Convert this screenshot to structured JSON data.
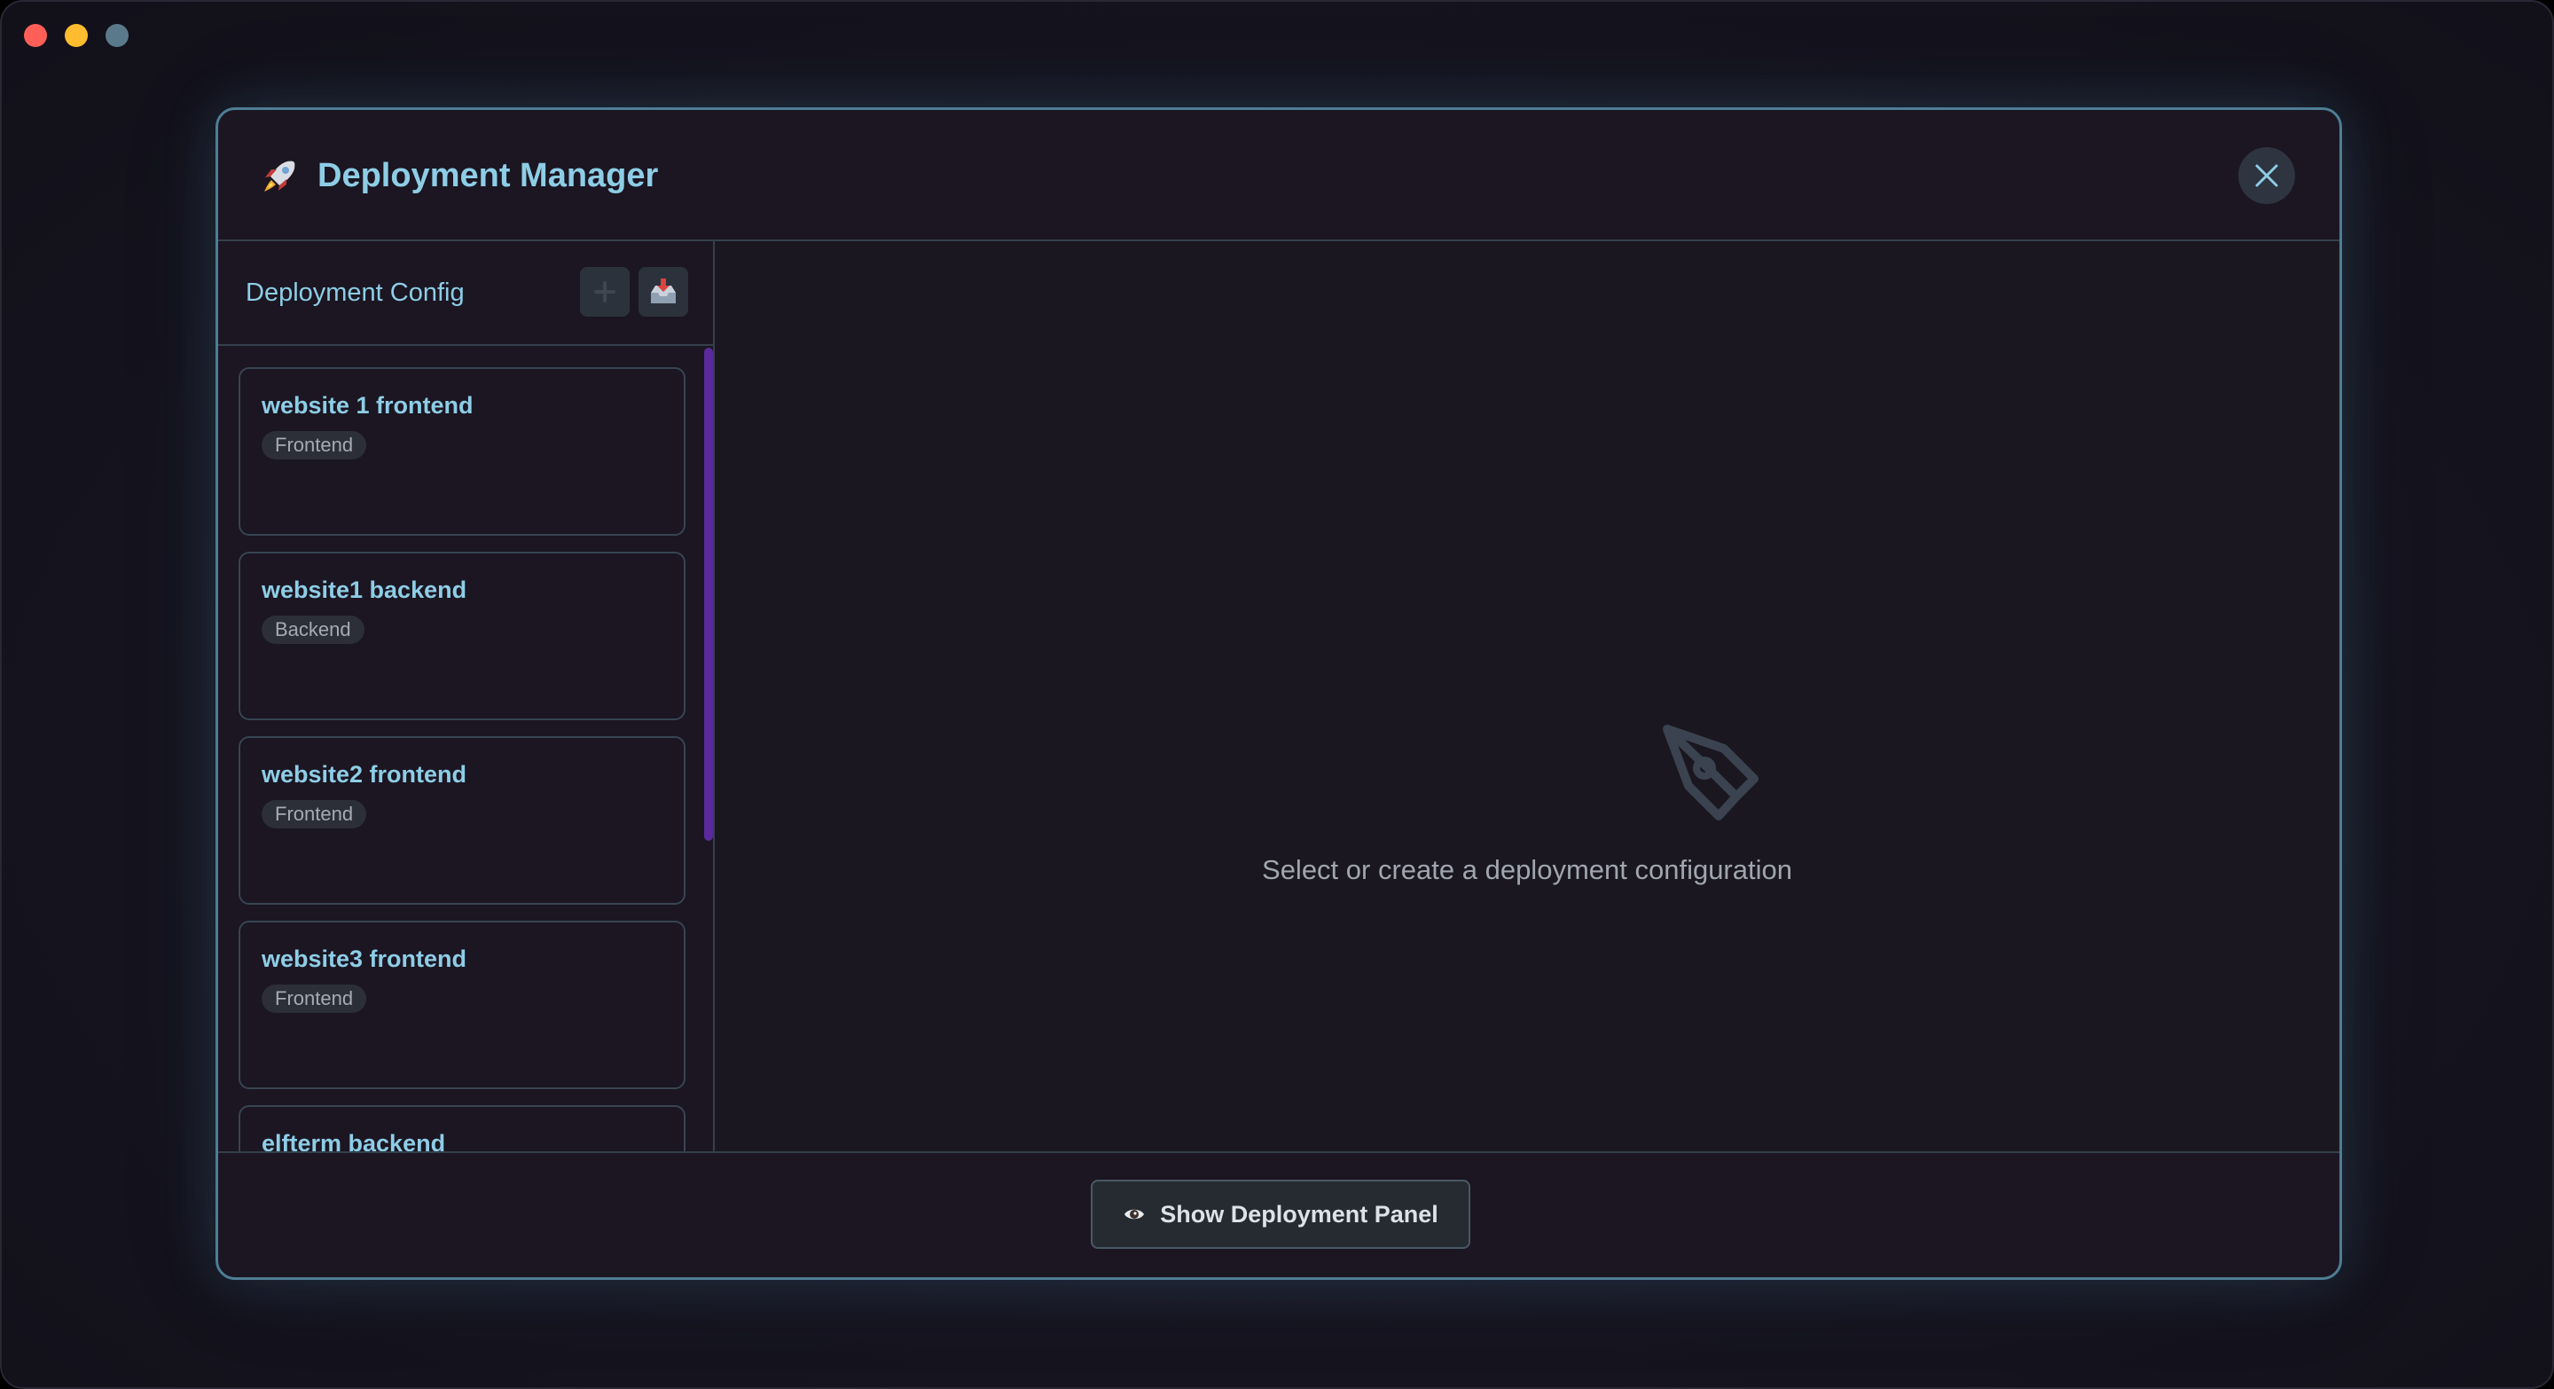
{
  "modal": {
    "title": "Deployment Manager",
    "header_icon": "rocket-icon",
    "close_icon": "close-icon"
  },
  "sidebar": {
    "title": "Deployment Config",
    "add_icon": "plus-icon",
    "import_icon": "inbox-tray-icon",
    "configs": [
      {
        "name": "website 1 frontend",
        "type": "Frontend"
      },
      {
        "name": "website1 backend",
        "type": "Backend"
      },
      {
        "name": "website2 frontend",
        "type": "Frontend"
      },
      {
        "name": "website3 frontend",
        "type": "Frontend"
      },
      {
        "name": "elfterm backend",
        "type": ""
      }
    ]
  },
  "main": {
    "empty_icon": "pen-nib-icon",
    "empty_message": "Select or create a deployment configuration"
  },
  "footer": {
    "show_panel_label": "Show Deployment Panel",
    "show_panel_icon": "eye-icon"
  },
  "colors": {
    "accent": "#8ecde6",
    "modal_border": "#4d7e94",
    "scrollbar": "#5a2a9c",
    "background": "#1b1622"
  }
}
